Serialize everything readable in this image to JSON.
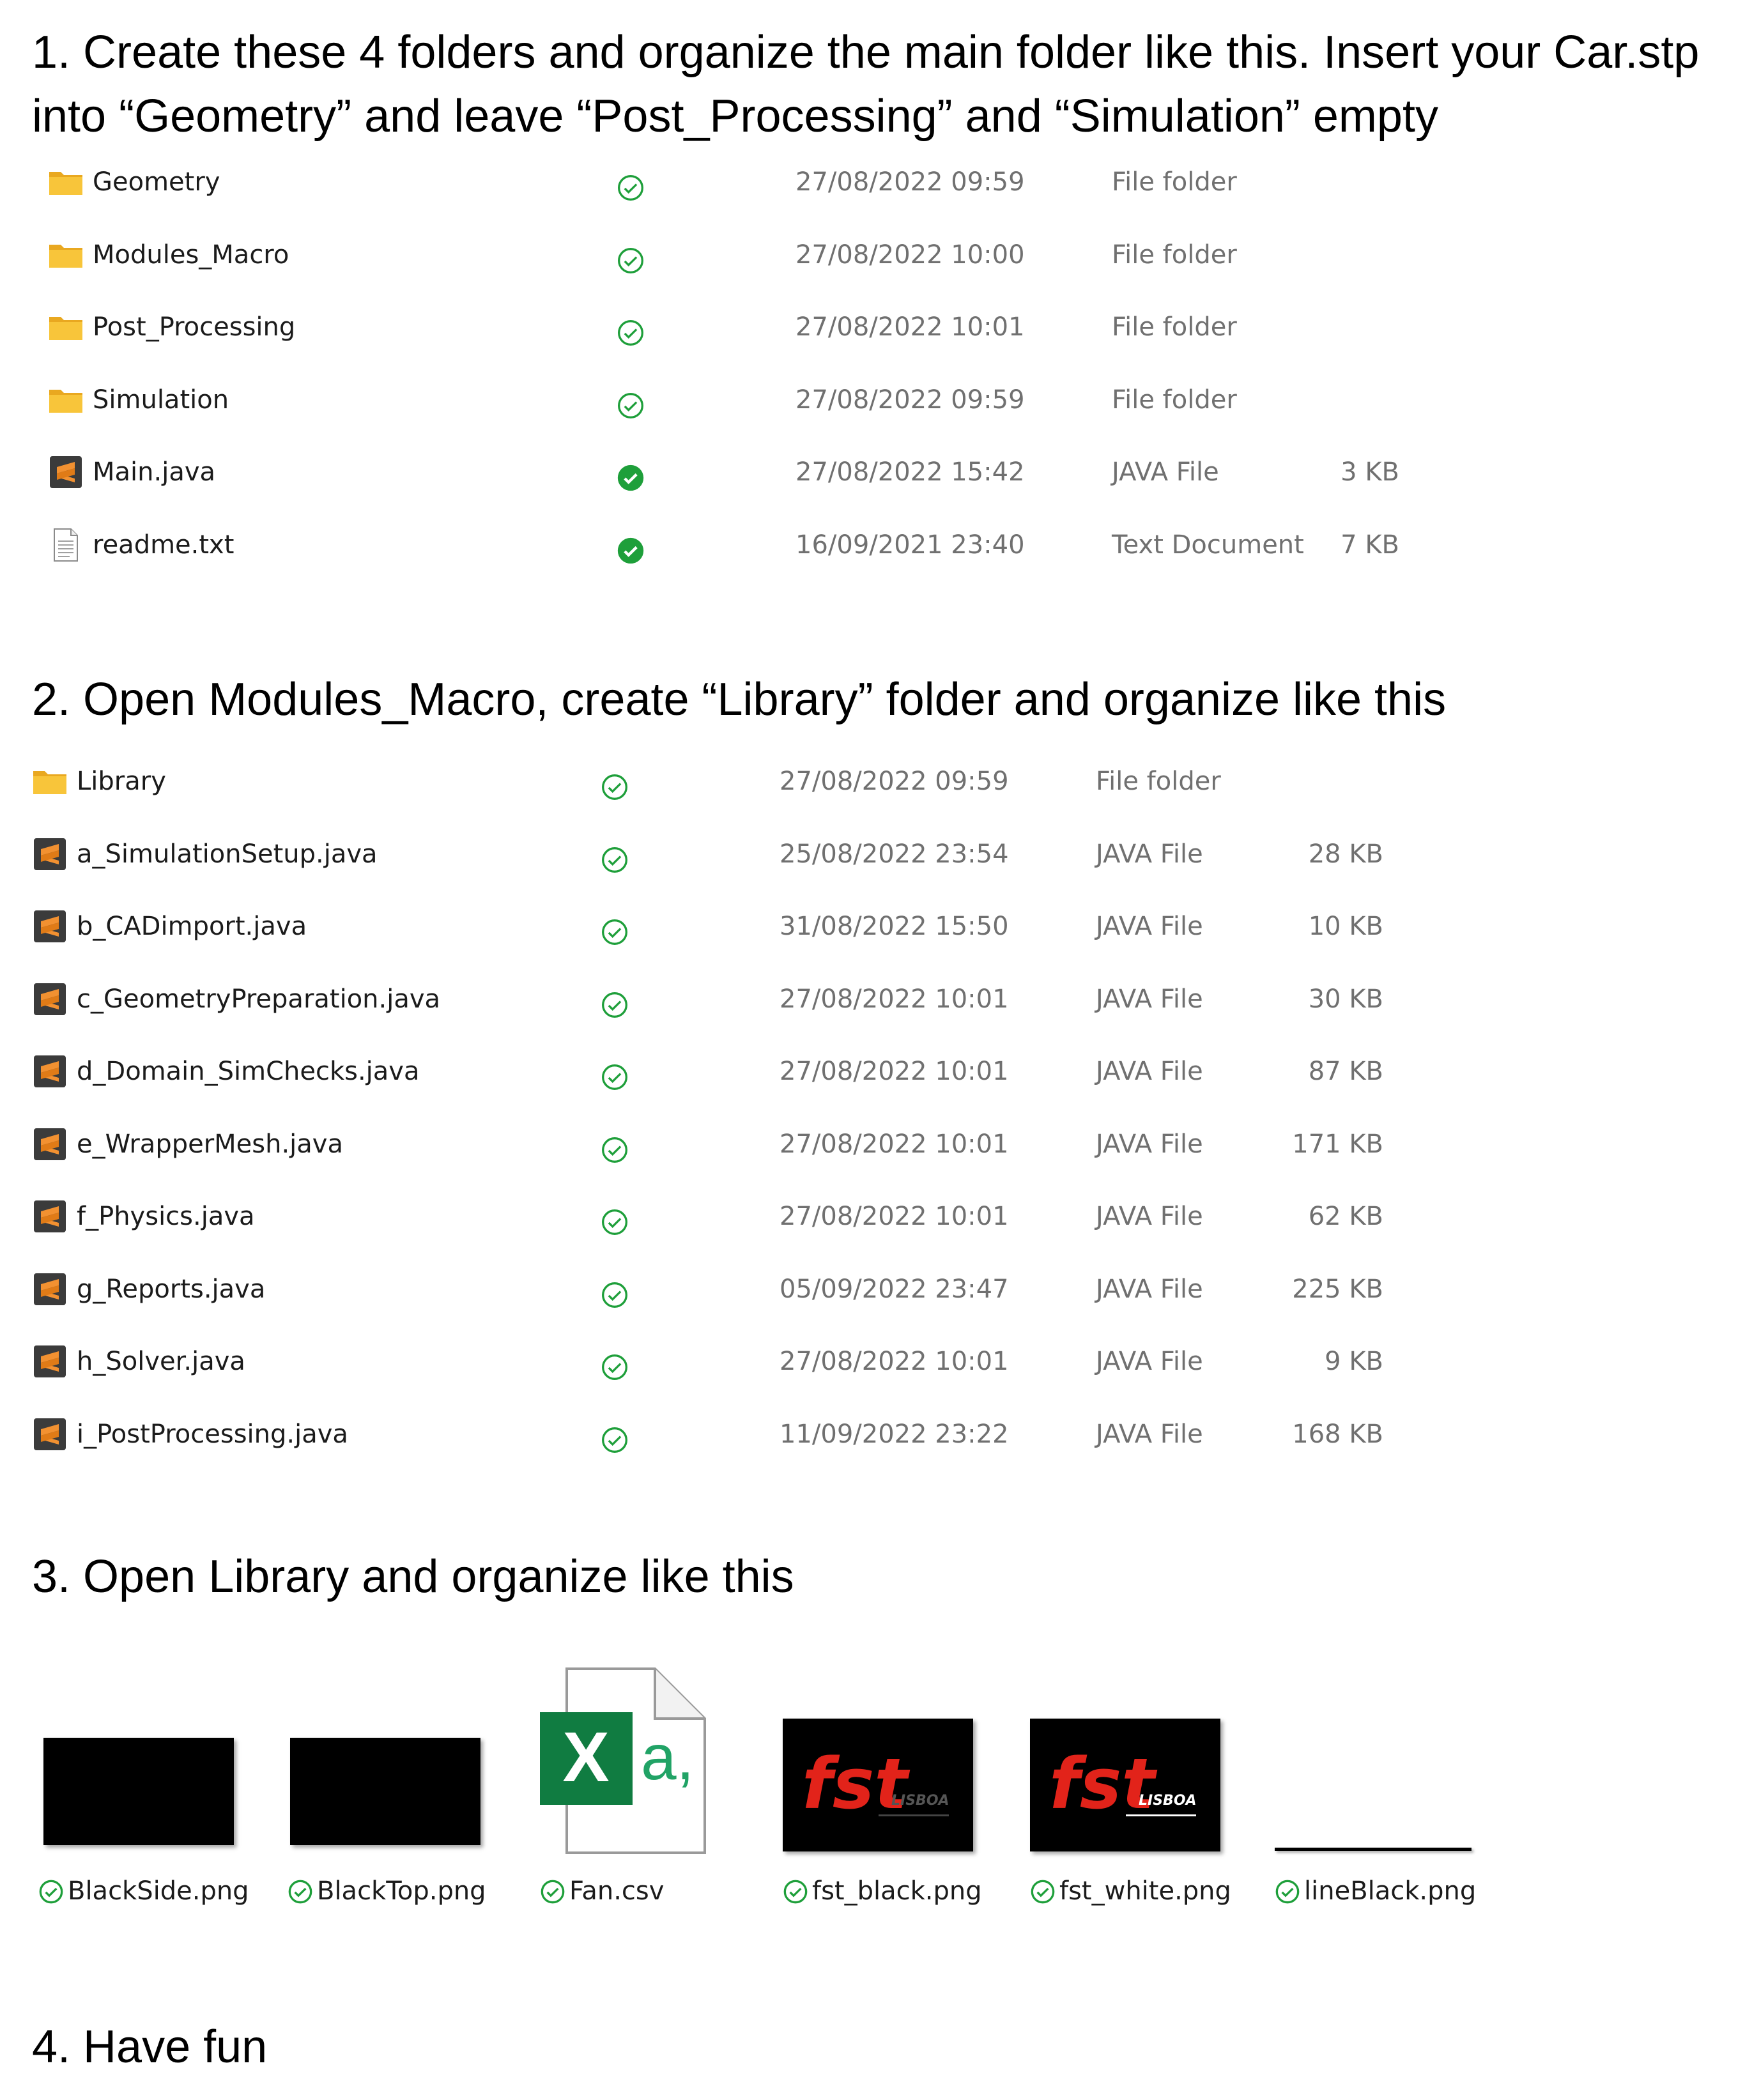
{
  "steps": {
    "step1": "1. Create these 4 folders and organize the main folder like this. Insert your Car.stp into “Geometry” and leave “Post_Processing” and “Simulation” empty",
    "step2": "2. Open Modules_Macro, create “Library” folder and organize like this",
    "step3": "3. Open Library and organize like this",
    "step4": "4. Have fun"
  },
  "main_folder": [
    {
      "name": "Geometry",
      "date": "27/08/2022 09:59",
      "type": "File folder",
      "size": "",
      "icon": "folder-icon",
      "sync": "synced-outline"
    },
    {
      "name": "Modules_Macro",
      "date": "27/08/2022 10:00",
      "type": "File folder",
      "size": "",
      "icon": "folder-icon",
      "sync": "synced-outline"
    },
    {
      "name": "Post_Processing",
      "date": "27/08/2022 10:01",
      "type": "File folder",
      "size": "",
      "icon": "folder-icon",
      "sync": "synced-outline"
    },
    {
      "name": "Simulation",
      "date": "27/08/2022 09:59",
      "type": "File folder",
      "size": "",
      "icon": "folder-icon",
      "sync": "synced-outline"
    },
    {
      "name": "Main.java",
      "date": "27/08/2022 15:42",
      "type": "JAVA File",
      "size": "3 KB",
      "icon": "sublime-file-icon",
      "sync": "synced-solid"
    },
    {
      "name": "readme.txt",
      "date": "16/09/2021 23:40",
      "type": "Text Document",
      "size": "7 KB",
      "icon": "text-file-icon",
      "sync": "synced-solid"
    }
  ],
  "modules_macro_folder": [
    {
      "name": "Library",
      "date": "27/08/2022 09:59",
      "type": "File folder",
      "size": "",
      "icon": "folder-icon"
    },
    {
      "name": "a_SimulationSetup.java",
      "date": "25/08/2022 23:54",
      "type": "JAVA File",
      "size": "28 KB",
      "icon": "sublime-file-icon"
    },
    {
      "name": "b_CADimport.java",
      "date": "31/08/2022 15:50",
      "type": "JAVA File",
      "size": "10 KB",
      "icon": "sublime-file-icon"
    },
    {
      "name": "c_GeometryPreparation.java",
      "date": "27/08/2022 10:01",
      "type": "JAVA File",
      "size": "30 KB",
      "icon": "sublime-file-icon"
    },
    {
      "name": "d_Domain_SimChecks.java",
      "date": "27/08/2022 10:01",
      "type": "JAVA File",
      "size": "87 KB",
      "icon": "sublime-file-icon"
    },
    {
      "name": "e_WrapperMesh.java",
      "date": "27/08/2022 10:01",
      "type": "JAVA File",
      "size": "171 KB",
      "icon": "sublime-file-icon"
    },
    {
      "name": "f_Physics.java",
      "date": "27/08/2022 10:01",
      "type": "JAVA File",
      "size": "62 KB",
      "icon": "sublime-file-icon"
    },
    {
      "name": "g_Reports.java",
      "date": "05/09/2022 23:47",
      "type": "JAVA File",
      "size": "225 KB",
      "icon": "sublime-file-icon"
    },
    {
      "name": "h_Solver.java",
      "date": "27/08/2022 10:01",
      "type": "JAVA File",
      "size": "9 KB",
      "icon": "sublime-file-icon"
    },
    {
      "name": "i_PostProcessing.java",
      "date": "11/09/2022 23:22",
      "type": "JAVA File",
      "size": "168 KB",
      "icon": "sublime-file-icon"
    }
  ],
  "library_folder": [
    {
      "name": "BlackSide.png",
      "thumb": "black-image-thumbnail"
    },
    {
      "name": "BlackTop.png",
      "thumb": "black-image-thumbnail"
    },
    {
      "name": "Fan.csv",
      "thumb": "excel-csv-icon"
    },
    {
      "name": "fst_black.png",
      "thumb": "fst-lisboa-logo-thumbnail"
    },
    {
      "name": "fst_white.png",
      "thumb": "fst-lisboa-logo-thumbnail"
    },
    {
      "name": "lineBlack.png",
      "thumb": "thin-line-thumbnail"
    }
  ],
  "colors": {
    "sync_green": "#1e9f3a",
    "folder_yellow": "#f8c53a",
    "sublime_orange": "#f29131",
    "excel_green": "#107c41",
    "fst_red": "#e2231a",
    "secondary_text": "#707070"
  },
  "library_logo_text": {
    "fst_black": {
      "brand": "fst",
      "sub": "LISBOA"
    },
    "fst_white": {
      "brand": "fst",
      "sub": "LISBOA"
    }
  },
  "excel_icon_letters": {
    "x": "X",
    "a": "a,"
  }
}
